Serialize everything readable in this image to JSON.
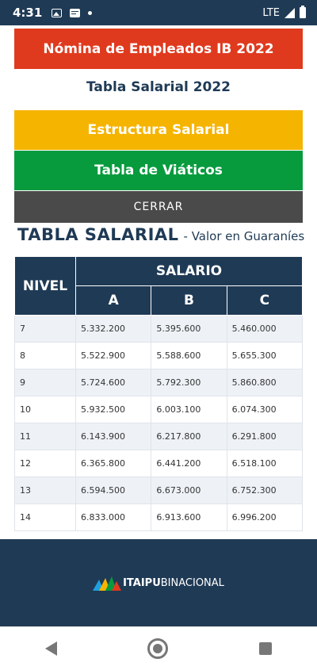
{
  "status_bar": {
    "time": "4:31",
    "network": "LTE",
    "icons": [
      "image-icon",
      "message-icon",
      "dot-icon",
      "signal-icon",
      "battery-icon"
    ]
  },
  "buttons": {
    "nomina": "Nómina de Empleados IB 2022",
    "estructura": "Estructura Salarial",
    "viaticos": "Tabla de Viáticos",
    "cerrar": "CERRAR"
  },
  "subtitle": "Tabla Salarial 2022",
  "table_heading": {
    "title": "TABLA SALARIAL",
    "suffix": "- Valor en Guaraníes"
  },
  "table": {
    "col_nivel": "NIVEL",
    "col_salario": "SALARIO",
    "col_a": "A",
    "col_b": "B",
    "col_c": "C",
    "rows": [
      {
        "nivel": "7",
        "a": "5.332.200",
        "b": "5.395.600",
        "c": "5.460.000"
      },
      {
        "nivel": "8",
        "a": "5.522.900",
        "b": "5.588.600",
        "c": "5.655.300"
      },
      {
        "nivel": "9",
        "a": "5.724.600",
        "b": "5.792.300",
        "c": "5.860.800"
      },
      {
        "nivel": "10",
        "a": "5.932.500",
        "b": "6.003.100",
        "c": "6.074.300"
      },
      {
        "nivel": "11",
        "a": "6.143.900",
        "b": "6.217.800",
        "c": "6.291.800"
      },
      {
        "nivel": "12",
        "a": "6.365.800",
        "b": "6.441.200",
        "c": "6.518.100"
      },
      {
        "nivel": "13",
        "a": "6.594.500",
        "b": "6.673.000",
        "c": "6.752.300"
      },
      {
        "nivel": "14",
        "a": "6.833.000",
        "b": "6.913.600",
        "c": "6.996.200"
      }
    ]
  },
  "footer": {
    "brand_bold": "ITAIPU",
    "brand_regular": "BINACIONAL"
  },
  "colors": {
    "navy": "#1f3a55",
    "red": "#e03a1e",
    "yellow": "#f5b400",
    "green": "#079b3e",
    "gray": "#4a4a4a"
  }
}
